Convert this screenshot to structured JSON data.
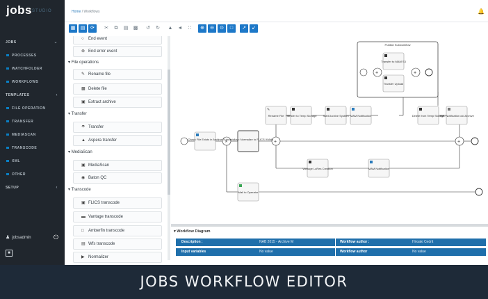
{
  "app": {
    "logo": "jobs",
    "logo_sub": "STUDIO"
  },
  "breadcrumb": {
    "home": "Home",
    "separator": "/",
    "current": "Workflows"
  },
  "sidebar": {
    "items": [
      {
        "label": "JOBS",
        "kind": "section",
        "chevron": "⌄"
      },
      {
        "label": "PROCESSES",
        "kind": "sub"
      },
      {
        "label": "WATCHFOLDER",
        "kind": "sub"
      },
      {
        "label": "WORKFLOWS",
        "kind": "sub"
      },
      {
        "label": "TEMPLATES",
        "kind": "section",
        "chevron": "‹"
      },
      {
        "label": "FILE OPERATION",
        "kind": "sub"
      },
      {
        "label": "TRANSFER",
        "kind": "sub"
      },
      {
        "label": "MEDIASCAN",
        "kind": "sub"
      },
      {
        "label": "TRANSCODE",
        "kind": "sub"
      },
      {
        "label": "XML",
        "kind": "sub"
      },
      {
        "label": "OTHER",
        "kind": "sub"
      },
      {
        "label": "SETUP",
        "kind": "section",
        "chevron": "‹"
      }
    ],
    "user": "jobsadmin"
  },
  "toolbar": {
    "icons": [
      "save-icon",
      "save-as-icon",
      "validate-icon",
      "cut-icon",
      "copy-icon",
      "paste-icon",
      "delete-icon",
      "undo-icon",
      "redo-icon",
      "align-icon",
      "distribute-icon",
      "connect-icon",
      "zoom-in-icon",
      "zoom-out-icon",
      "zoom-reset-icon",
      "fit-icon",
      "expand-icon",
      "collapse-icon"
    ]
  },
  "palette": {
    "top_items": [
      "End event",
      "End error event"
    ],
    "groups": [
      {
        "title": "File operations",
        "items": [
          "Rename file",
          "Delete file",
          "Extract archive"
        ]
      },
      {
        "title": "Transfer",
        "items": [
          "Transfer",
          "Aspera transfer"
        ]
      },
      {
        "title": "MediaScan",
        "items": [
          "MediaScan",
          "Baton QC"
        ]
      },
      {
        "title": "Transcode",
        "items": [
          "FLICS transcode",
          "Vantage transcode",
          "Amberfin transcode",
          "Wfs transcode",
          "Normalizer"
        ]
      }
    ]
  },
  "diagram": {
    "subprocess_title": "Publish Subworkflow",
    "nodes": {
      "check_file": "Check File Exists in Archive",
      "subworkflow": "Subworkflow: Normalize to FLICS XMIds",
      "rename": "Rename File",
      "transfer_temp": "Transfer to Temp Storage",
      "start_archive": "Start Archive System",
      "mam_notif_1": "MAM Notification",
      "transfer_mam": "Transfer to MAM S3",
      "transfer_upload": "Transfer Upload",
      "delete_temp": "Delete from Temp Storage",
      "xml_notif": "XML Notification old Archive",
      "vantage": "Vantage LoRes Creation",
      "mam_notif_2": "MAM Notification",
      "mail_operator": "Mail to Operator"
    }
  },
  "bottom_panel": {
    "title": "Workflow Diagram",
    "rows": [
      {
        "k1": "Description :",
        "v1": "NAB 2015 - Archive M",
        "k2": "Workflow author :",
        "v2": "Hiroaki Cedrit"
      },
      {
        "k1": "Input variables",
        "v1": "No value",
        "k2": "Workflow author",
        "v2": "No value"
      }
    ]
  },
  "caption": "JOBS WORKFLOW EDITOR"
}
